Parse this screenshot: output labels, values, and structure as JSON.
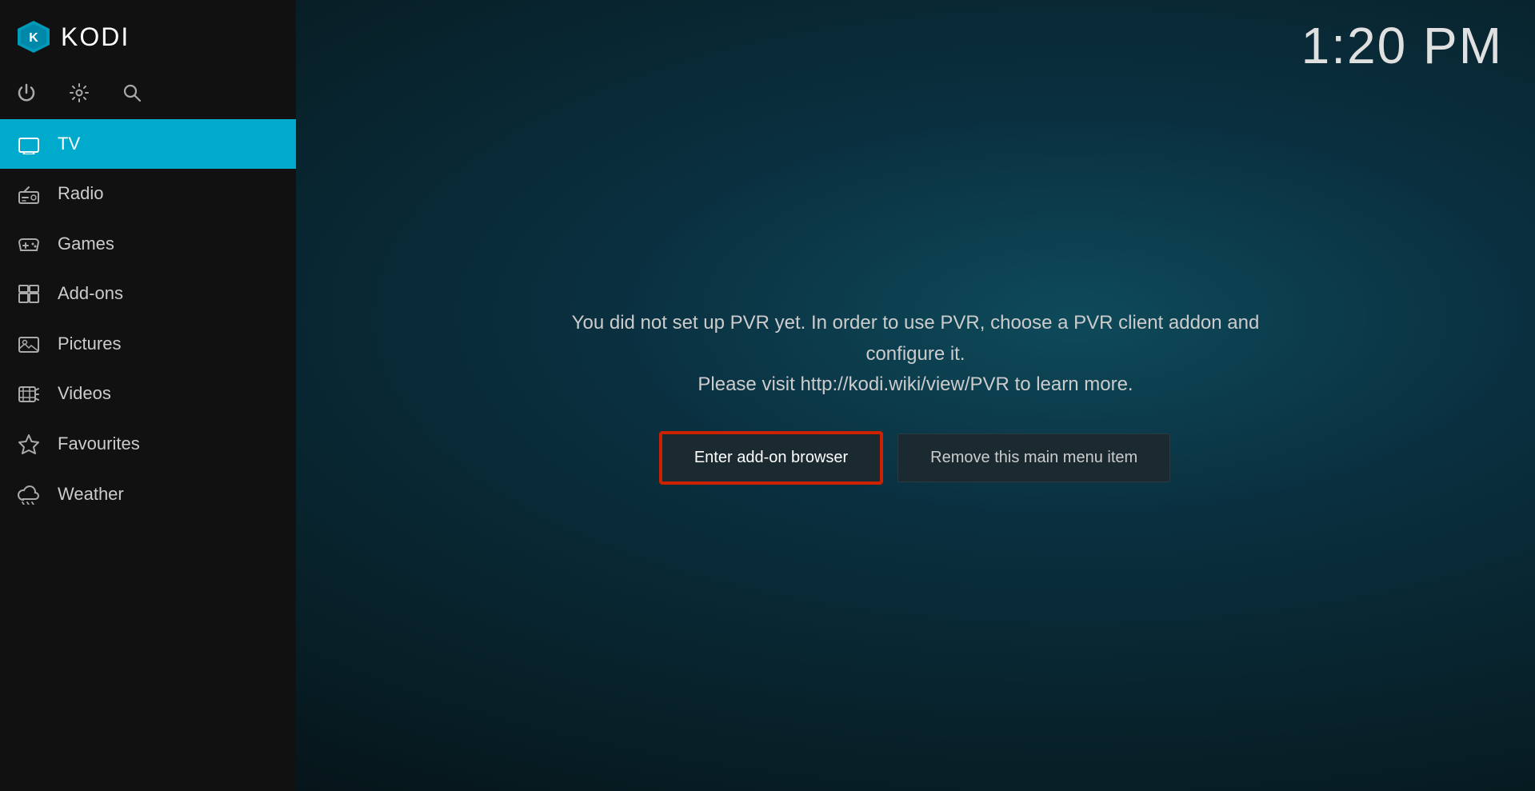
{
  "app": {
    "title": "KODI",
    "clock": "1:20 PM"
  },
  "sidebar": {
    "nav_items": [
      {
        "id": "tv",
        "label": "TV",
        "icon": "tv-icon",
        "active": true
      },
      {
        "id": "radio",
        "label": "Radio",
        "icon": "radio-icon",
        "active": false
      },
      {
        "id": "games",
        "label": "Games",
        "icon": "gamepad-icon",
        "active": false
      },
      {
        "id": "addons",
        "label": "Add-ons",
        "icon": "addons-icon",
        "active": false
      },
      {
        "id": "pictures",
        "label": "Pictures",
        "icon": "pictures-icon",
        "active": false
      },
      {
        "id": "videos",
        "label": "Videos",
        "icon": "videos-icon",
        "active": false
      },
      {
        "id": "favourites",
        "label": "Favourites",
        "icon": "star-icon",
        "active": false
      },
      {
        "id": "weather",
        "label": "Weather",
        "icon": "weather-icon",
        "active": false
      }
    ]
  },
  "main": {
    "pvr_message_line1": "You did not set up PVR yet. In order to use PVR, choose a PVR client addon and configure it.",
    "pvr_message_line2": "Please visit http://kodi.wiki/view/PVR to learn more.",
    "btn_addon_browser": "Enter add-on browser",
    "btn_remove": "Remove this main menu item"
  },
  "topbar": {
    "power_label": "power",
    "settings_label": "settings",
    "search_label": "search"
  }
}
